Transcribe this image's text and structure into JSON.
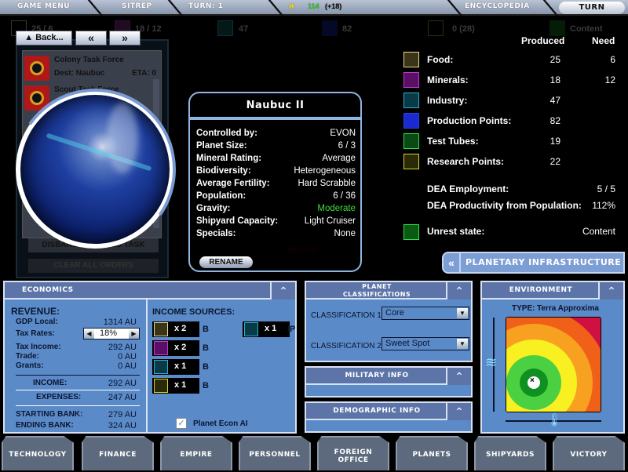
{
  "topbar": {
    "game_menu": "GAME MENU",
    "sitrep": "SITREP",
    "turn_label": "TURN: 1",
    "currency_icon": "AU-icon",
    "treasury": "114",
    "treasury_delta": "(+18)",
    "encyclopedia": "ENCYCLOPEDIA",
    "turn_button": "TURN"
  },
  "summary_bar": {
    "food": "25 / 6",
    "minerals": "18 / 12",
    "industry": "47",
    "production": "82",
    "research": "0 (28)",
    "unrest": "Content"
  },
  "nav": {
    "back": "▲ Back...",
    "prev": "«",
    "next": "»"
  },
  "fleets": [
    {
      "name": "Colony Task Force",
      "dest": "Dest: Naubuc",
      "eta": "ETA: 0"
    },
    {
      "name": "Scout Task Force",
      "dest": "",
      "eta": ""
    }
  ],
  "fleet_buttons": {
    "disband": "DISBAND SELECTED TASK FORCE",
    "clear": "CLEAR ALL ORDERS"
  },
  "planet": {
    "name": "Naubuc II",
    "map_label": "Naubuc",
    "rows": [
      {
        "label": "Controlled by:",
        "value": "EVON"
      },
      {
        "label": "Planet Size:",
        "value": "6 / 3"
      },
      {
        "label": "Mineral Rating:",
        "value": "Average"
      },
      {
        "label": "Biodiversity:",
        "value": "Heterogeneous"
      },
      {
        "label": "Average Fertility:",
        "value": "Hard Scrabble"
      },
      {
        "label": "Population:",
        "value": "6 / 36"
      },
      {
        "label": "Gravity:",
        "value": "Moderate"
      },
      {
        "label": "Shipyard Capacity:",
        "value": "Light Cruiser"
      },
      {
        "label": "Specials:",
        "value": "None"
      }
    ],
    "rename": "RENAME",
    "gravity_color": "#3ddc3d"
  },
  "stats": {
    "produced_header": "Produced",
    "need_header": "Need",
    "rows": [
      {
        "icon": "food-icon",
        "label": "Food:",
        "produced": "25",
        "need": "6",
        "color": "#e8d890"
      },
      {
        "icon": "minerals-icon",
        "label": "Minerals:",
        "produced": "18",
        "need": "12",
        "color": "#c03ad0"
      },
      {
        "icon": "industry-icon",
        "label": "Industry:",
        "produced": "47",
        "need": "",
        "color": "#2ab0c8"
      },
      {
        "icon": "production-icon",
        "label": "Production Points:",
        "produced": "82",
        "need": "",
        "color": "#2244e0"
      },
      {
        "icon": "test-tube-icon",
        "label": "Test Tubes:",
        "produced": "19",
        "need": "",
        "color": "#2ee04a"
      },
      {
        "icon": "research-icon",
        "label": "Research Points:",
        "produced": "22",
        "need": "",
        "color": "#d4d428"
      }
    ],
    "dea_employment_label": "DEA Employment:",
    "dea_employment": "5 / 5",
    "dea_productivity_label": "DEA Productivity from Population:",
    "dea_productivity": "112%",
    "unrest_label": "Unrest state:",
    "unrest": "Content"
  },
  "infrastructure_button": "PLANETARY INFRASTRUCTURE",
  "economics": {
    "title": "ECONOMICS",
    "revenue": "REVENUE:",
    "gdp_label": "GDP Local:",
    "gdp": "1314 AU",
    "tax_label": "Tax Rates:",
    "tax_rate": "18%",
    "tax_income_label": "Tax Income:",
    "tax_income": "292 AU",
    "trade_label": "Trade:",
    "trade": "0 AU",
    "grants_label": "Grants:",
    "grants": "0 AU",
    "income_label": "INCOME:",
    "income": "292 AU",
    "expenses_label": "EXPENSES:",
    "expenses": "247 AU",
    "starting_bank_label": "STARTING BANK:",
    "starting_bank": "279 AU",
    "ending_bank_label": "ENDING BANK:",
    "ending_bank": "324 AU",
    "income_sources_label": "INCOME SOURCES:",
    "sources": [
      {
        "icon": "food-icon",
        "mult": "x 2",
        "type": "B",
        "color": "#e8d890"
      },
      {
        "icon": "minerals-icon",
        "mult": "x 2",
        "type": "B",
        "color": "#c03ad0"
      },
      {
        "icon": "industry-icon",
        "mult": "x 1",
        "type": "B",
        "color": "#2ab0c8"
      },
      {
        "icon": "research-icon",
        "mult": "x 1",
        "type": "B",
        "color": "#d4d428"
      },
      {
        "icon": "industry-icon",
        "mult": "x 1",
        "type": "IP",
        "color": "#2ab0c8"
      }
    ],
    "econ_ai_label": "Planet Econ AI",
    "econ_ai_checked": true
  },
  "classifications": {
    "title_line1": "PLANET",
    "title_line2": "CLASSIFICATIONS",
    "c1_label": "CLASSIFICATION 1",
    "c1_value": "Core",
    "c2_label": "CLASSIFICATION 2",
    "c2_value": "Sweet Spot"
  },
  "military": {
    "title": "MILITARY INFO"
  },
  "demographic": {
    "title": "DEMOGRAPHIC INFO"
  },
  "environment": {
    "title": "ENVIRONMENT",
    "type_label": "TYPE:",
    "type_value": "Terra Approxima"
  },
  "tabs": [
    {
      "label": "TECHNOLOGY"
    },
    {
      "label": "FINANCE"
    },
    {
      "label": "EMPIRE"
    },
    {
      "label": "PERSONNEL"
    },
    {
      "label": "FOREIGN OFFICE"
    },
    {
      "label": "PLANETS"
    },
    {
      "label": "SHIPYARDS"
    },
    {
      "label": "VICTORY"
    }
  ]
}
